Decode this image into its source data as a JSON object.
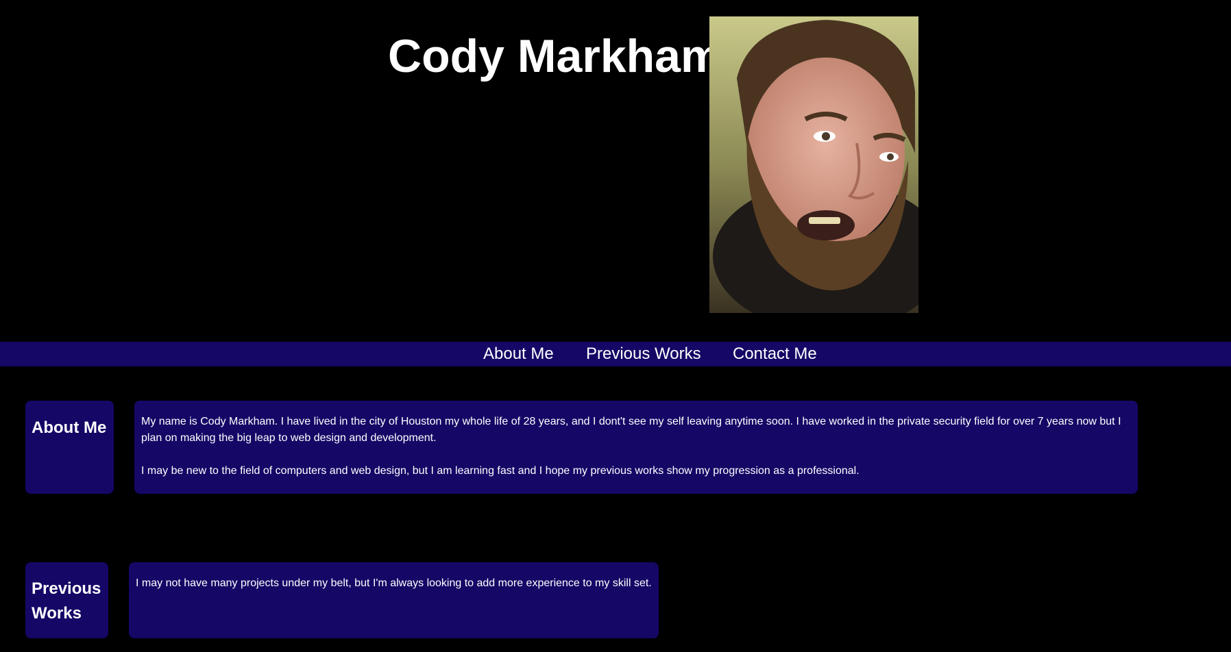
{
  "header": {
    "title": "Cody Markham",
    "portrait_icon": "portrait-photo"
  },
  "nav": {
    "about_label": "About Me",
    "works_label": "Previous Works",
    "contact_label": "Contact Me"
  },
  "about": {
    "heading": "About Me",
    "paragraph_1": "My name is Cody Markham. I have lived in the city of Houston my whole life of 28 years, and I dont't see my self leaving anytime soon. I have worked in the private security field for over 7 years now but I plan on making the big leap to web design and development.",
    "paragraph_2": "I may be new to the field of computers and web design, but I am learning fast and I hope my previous works show my progression as a professional."
  },
  "works": {
    "heading": "Previous Works",
    "paragraph_1": "I may not have many projects under my belt, but I'm always looking to add more experience to my skill set."
  },
  "colors": {
    "background": "#000000",
    "accent": "#150766",
    "text": "#ffffff"
  }
}
